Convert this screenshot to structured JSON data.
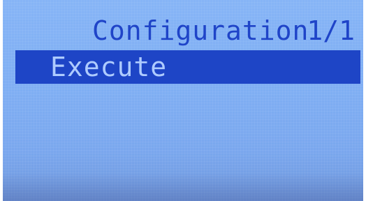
{
  "header": {
    "title": "Configuration",
    "page_indicator": "1/1"
  },
  "menu": {
    "items": [
      {
        "label": "Execute",
        "selected": true
      }
    ]
  },
  "colors": {
    "screen_background": "#80aff4",
    "text": "#1f44c8",
    "selection_background": "#1e45c6",
    "selection_text": "#aecbff"
  }
}
